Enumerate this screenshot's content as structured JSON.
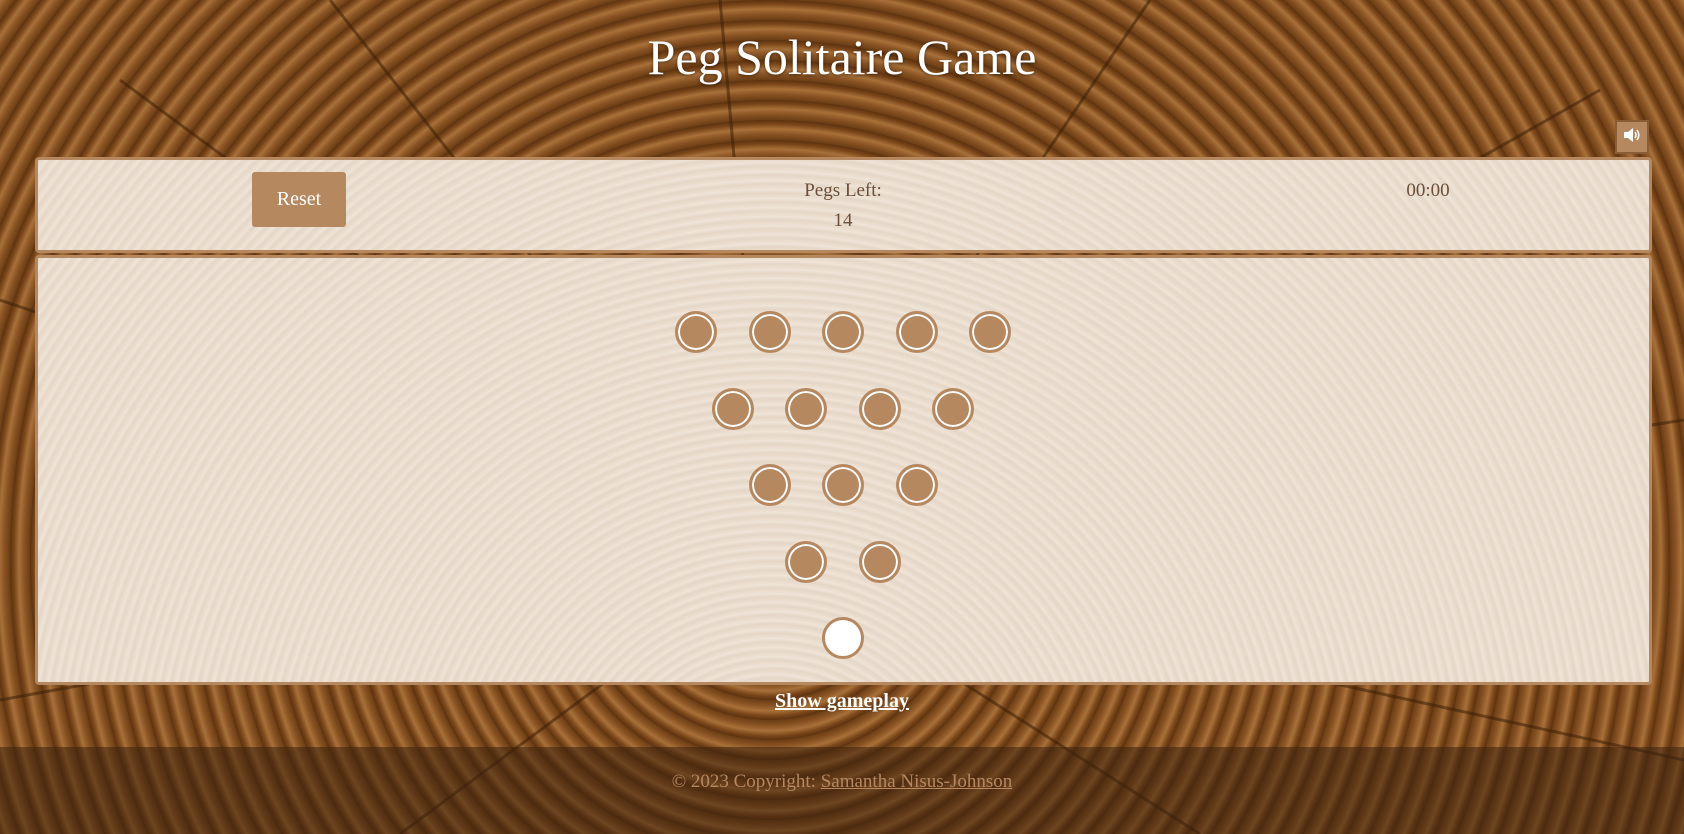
{
  "header": {
    "title": "Peg Solitaire Game"
  },
  "sound": {
    "icon": "speaker-icon"
  },
  "status": {
    "reset_label": "Reset",
    "pegs_left_label": "Pegs Left:",
    "pegs_left_value": "14",
    "timer": "00:00"
  },
  "board": {
    "rows": [
      [
        1,
        1,
        1,
        1,
        1
      ],
      [
        1,
        1,
        1,
        1
      ],
      [
        1,
        1,
        1
      ],
      [
        1,
        1
      ],
      [
        0
      ]
    ],
    "colors": {
      "peg": "#b58860",
      "empty": "#ffffff"
    }
  },
  "links": {
    "show_gameplay": "Show gameplay"
  },
  "footer": {
    "copyright": "© 2023 Copyright:",
    "author": "Samantha Nisus-Johnson"
  }
}
